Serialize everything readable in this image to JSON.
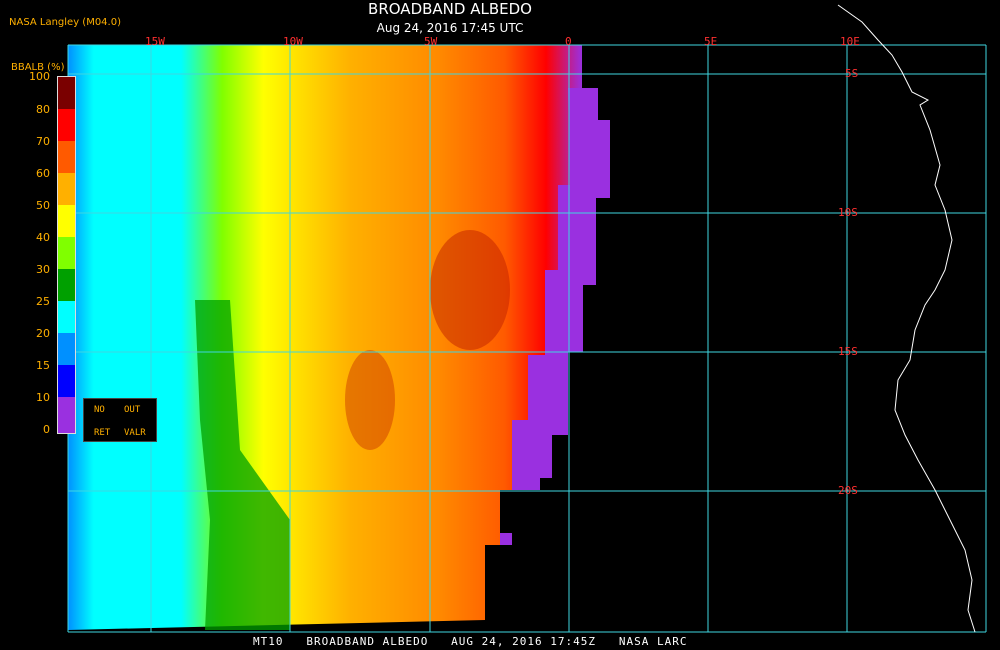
{
  "header": {
    "org": "NASA Langley (M04.0)",
    "title": "BROADBAND ALBEDO",
    "subtitle": "Aug 24, 2016 17:45 UTC"
  },
  "map": {
    "lon_labels": [
      "15W",
      "10W",
      "5W",
      "0",
      "5E",
      "10E"
    ],
    "lat_labels": [
      "5S",
      "10S",
      "15S",
      "20S"
    ],
    "colors": {
      "grid": "#3fd6e0",
      "label": "#ff3030",
      "coast": "#ffffff",
      "background": "#000000"
    }
  },
  "legend": {
    "title": "BBALB (%)",
    "ticks": [
      "100",
      "80",
      "70",
      "60",
      "50",
      "40",
      "30",
      "25",
      "20",
      "15",
      "10",
      "0"
    ],
    "colors": [
      "#7a0000",
      "#ff0000",
      "#ff5a00",
      "#ffb000",
      "#ffff00",
      "#80ff00",
      "#00a000",
      "#00ffff",
      "#0090ff",
      "#0000ff",
      "#9a30e0"
    ],
    "flags": [
      "NO",
      "OUT",
      "RET",
      "VALR"
    ]
  },
  "footer": "MT10   BROADBAND ALBEDO   AUG 24, 2016 17:45Z   NASA LARC"
}
